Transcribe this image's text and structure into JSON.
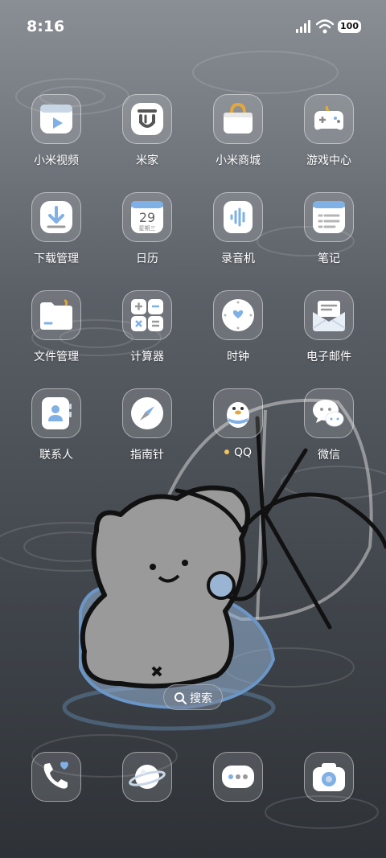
{
  "status_bar": {
    "time": "8:16",
    "battery": "100",
    "icons": [
      "signal-icon",
      "wifi-icon",
      "battery-icon"
    ]
  },
  "apps": [
    {
      "label": "小米视频",
      "icon": "video-play-icon"
    },
    {
      "label": "米家",
      "icon": "mijia-icon"
    },
    {
      "label": "小米商城",
      "icon": "shopping-bag-icon"
    },
    {
      "label": "游戏中心",
      "icon": "gamepad-icon"
    },
    {
      "label": "下载管理",
      "icon": "download-icon"
    },
    {
      "label": "日历",
      "icon": "calendar-icon",
      "date": "29",
      "weekday": "星期三"
    },
    {
      "label": "录音机",
      "icon": "voice-recorder-icon"
    },
    {
      "label": "笔记",
      "icon": "notes-icon"
    },
    {
      "label": "文件管理",
      "icon": "folder-icon"
    },
    {
      "label": "计算器",
      "icon": "calculator-icon"
    },
    {
      "label": "时钟",
      "icon": "clock-icon"
    },
    {
      "label": "电子邮件",
      "icon": "mail-icon"
    },
    {
      "label": "联系人",
      "icon": "contacts-icon"
    },
    {
      "label": "指南针",
      "icon": "compass-icon"
    },
    {
      "label": "QQ",
      "icon": "qq-penguin-icon",
      "badge": "new-install-dot"
    },
    {
      "label": "微信",
      "icon": "wechat-icon"
    }
  ],
  "search": {
    "label": "搜索",
    "icon": "search-icon"
  },
  "dock": [
    {
      "icon": "phone-icon"
    },
    {
      "icon": "browser-planet-icon"
    },
    {
      "icon": "messages-icon"
    },
    {
      "icon": "camera-icon"
    }
  ],
  "colors": {
    "accent_blue": "#7fb0e6",
    "badge_yellow": "#f5c35a",
    "icon_bg": "#ffffff"
  }
}
